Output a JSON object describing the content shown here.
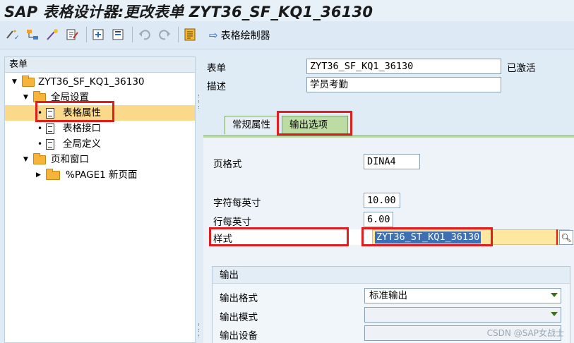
{
  "window": {
    "title": "SAP 表格设计器:更改表单 ZYT36_SF_KQ1_36130"
  },
  "toolbar": {
    "icons": [
      "wand-check-icon",
      "hierarchy-icon",
      "magic-wand-icon",
      "edit-doc-icon",
      "insert-icon",
      "delete-icon",
      "undo-icon",
      "redo-icon",
      "form-painter-icon"
    ],
    "form_painter_label": "表格绘制器"
  },
  "tree": {
    "header": "表单",
    "items": [
      {
        "label": "ZYT36_SF_KQ1_36130",
        "type": "folder",
        "expanded": true
      },
      {
        "label": "全局设置",
        "type": "folder",
        "expanded": true
      },
      {
        "label": "表格属性",
        "type": "doc",
        "selected": true
      },
      {
        "label": "表格接口",
        "type": "doc"
      },
      {
        "label": "全局定义",
        "type": "doc"
      },
      {
        "label": "页和窗口",
        "type": "folder",
        "expanded": true
      },
      {
        "label": "%PAGE1 新页面",
        "type": "folder",
        "expanded": false
      }
    ]
  },
  "header_fields": {
    "form_label": "表单",
    "form_value": "ZYT36_SF_KQ1_36130",
    "status": "已激活",
    "desc_label": "描述",
    "desc_value": "学员考勤"
  },
  "tabs": [
    {
      "label": "常规属性",
      "active": false
    },
    {
      "label": "输出选项",
      "active": true
    }
  ],
  "output_options": {
    "page_format_label": "页格式",
    "page_format_value": "DINA4",
    "cpi_label": "字符每英寸",
    "cpi_value": "10.00",
    "lpi_label": "行每英寸",
    "lpi_value": "6.00",
    "style_label": "样式",
    "style_value": "ZYT36_ST_KQ1_36130"
  },
  "output_group": {
    "title": "输出",
    "format_label": "输出格式",
    "format_value": "标准输出",
    "mode_label": "输出模式",
    "mode_value": "",
    "device_label": "输出设备",
    "device_value": ""
  },
  "watermark": "CSDN @SAP女战士",
  "colors": {
    "highlight_red": "#e21d1d",
    "selection": "#fbd98b",
    "active_tab": "#bcdca3",
    "style_field": "#fde7a1"
  }
}
